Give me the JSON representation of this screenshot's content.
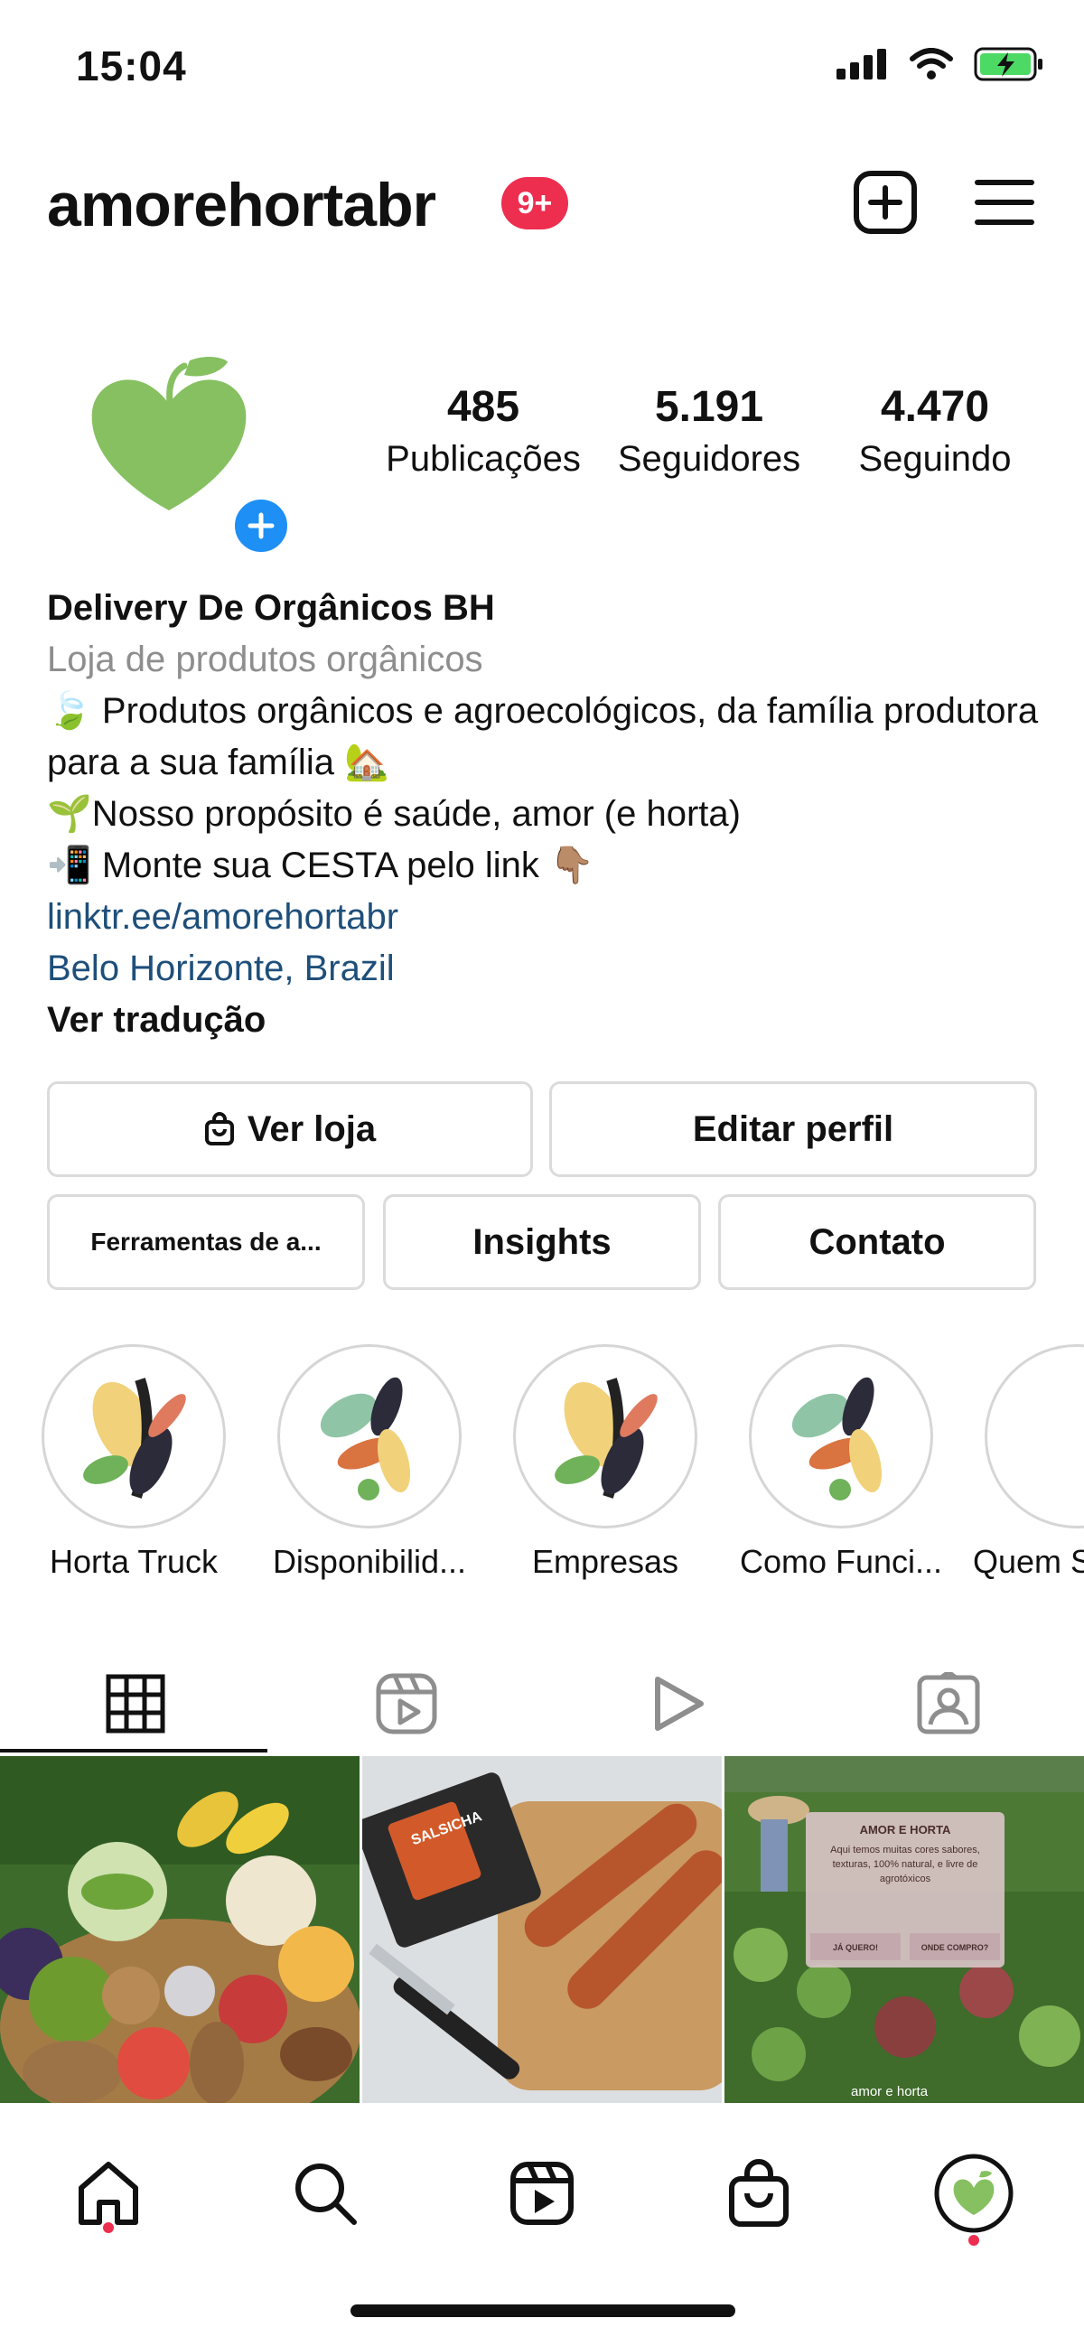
{
  "status_bar": {
    "time": "15:04"
  },
  "header": {
    "username": "amorehortabr",
    "notifications_badge": "9+"
  },
  "profile": {
    "stats": [
      {
        "value": "485",
        "label": "Publicações"
      },
      {
        "value": "5.191",
        "label": "Seguidores"
      },
      {
        "value": "4.470",
        "label": "Seguindo"
      }
    ],
    "bio": {
      "name": "Delivery De Orgânicos BH",
      "category": "Loja de produtos orgânicos",
      "line1": "🍃 Produtos orgânicos e agroecológicos, da família produtora para a sua família 🏡",
      "line2": "🌱Nosso propósito é saúde, amor (e horta)",
      "line3": "📲 Monte sua CESTA pelo link 👇🏽",
      "link": "linktr.ee/amorehortabr",
      "location": "Belo Horizonte, Brazil",
      "translate": "Ver tradução"
    }
  },
  "buttons": {
    "shop": "Ver loja",
    "edit_profile": "Editar perfil",
    "tools": "Ferramentas de a...",
    "insights": "Insights",
    "contact": "Contato"
  },
  "highlights": [
    {
      "label": "Horta Truck"
    },
    {
      "label": "Disponibilid..."
    },
    {
      "label": "Empresas"
    },
    {
      "label": "Como Funci..."
    },
    {
      "label": "Quem S"
    }
  ],
  "tabs": [
    {
      "icon": "grid-icon"
    },
    {
      "icon": "reels-icon"
    },
    {
      "icon": "play-icon"
    },
    {
      "icon": "tagged-icon"
    }
  ],
  "posts": {
    "third": {
      "title": "AMOR E HORTA",
      "text": "Aqui temos muitas cores sabores, texturas, 100% natural, e livre de agrotóxicos",
      "btn1": "JÁ QUERO!",
      "btn2": "ONDE COMPRO?",
      "brand": "amor e horta"
    },
    "second": {
      "package": "SALSICHA"
    }
  },
  "bottom_nav": [
    {
      "icon": "home-icon"
    },
    {
      "icon": "search-icon"
    },
    {
      "icon": "reels-icon"
    },
    {
      "icon": "shop-icon"
    },
    {
      "icon": "profile-avatar"
    }
  ],
  "colors": {
    "badge": "#ed2e4f",
    "link": "#1e4f7a",
    "add_button": "#1d8ff5",
    "brand_green": "#7dc35b"
  }
}
